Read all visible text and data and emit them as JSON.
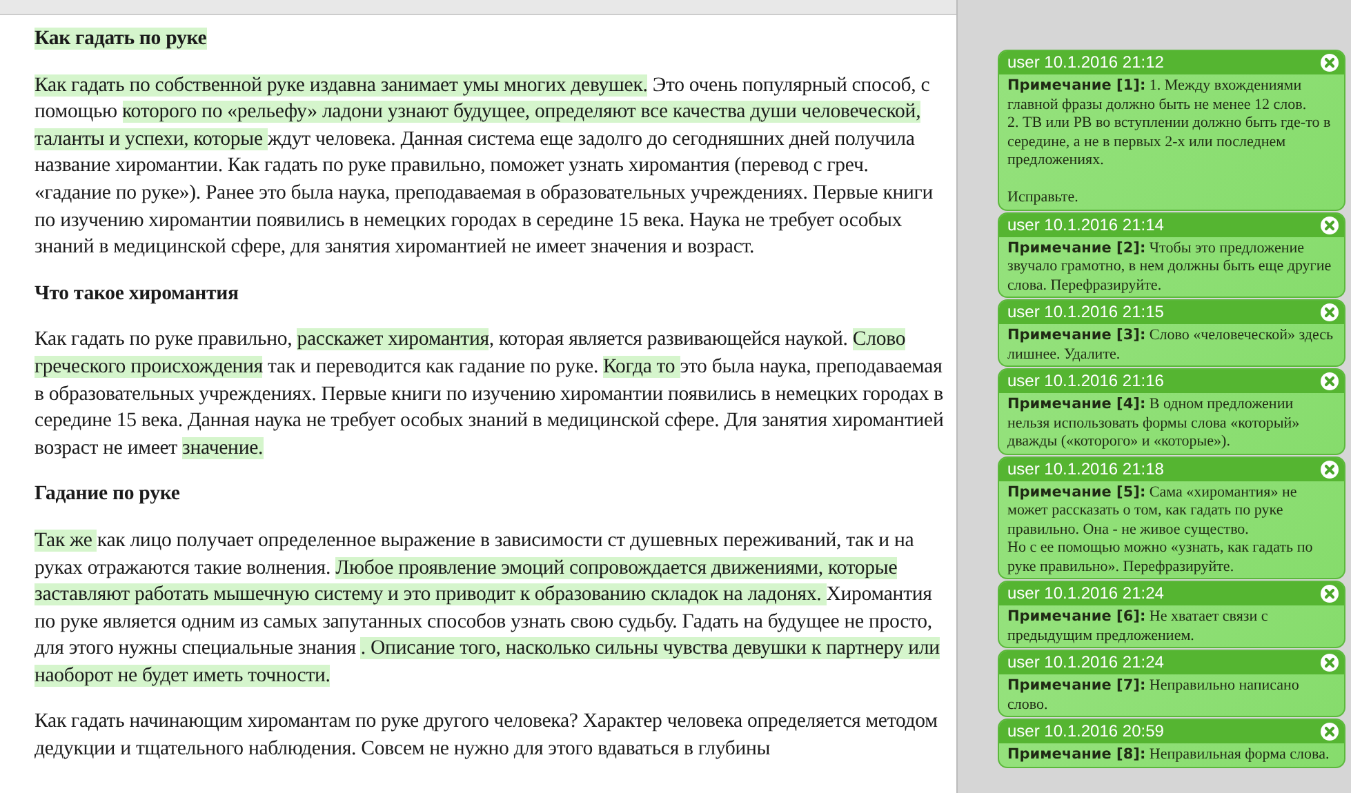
{
  "document": {
    "blocks": [
      {
        "kind": "heading",
        "segments": [
          {
            "text": "Как гадать по руке",
            "highlighted": true
          }
        ]
      },
      {
        "kind": "paragraph",
        "segments": [
          {
            "text": "Как гадать по собственной руке ",
            "highlighted": true
          },
          {
            "text": "издавна занимает умы многих девушек.",
            "highlighted": true
          },
          {
            "text": " Это очень популярный способ, с помощью ",
            "highlighted": false
          },
          {
            "text": "которого по «рельефу» ладони узнают будущее, определяют все качества ",
            "highlighted": true
          },
          {
            "text": "души человеческой",
            "highlighted": true
          },
          {
            "text": ", таланты и успехи, которые ",
            "highlighted": true
          },
          {
            "text": "ждут человека. Данная система еще задолго до сегодняшних дней получила название хиромантии. Как гадать по руке правильно, поможет узнать хиромантия (перевод с греч. «гадание по руке»). Ранее это была наука, преподаваемая в образовательных учреждениях. Первые книги по изучению хиромантии появились в немецких городах в середине 15 века. Наука не требует особых знаний в медицинской сфере, для занятия хиромантией не имеет значения и возраст.",
            "highlighted": false
          }
        ]
      },
      {
        "kind": "heading",
        "segments": [
          {
            "text": "Что такое хиромантия",
            "highlighted": false
          }
        ]
      },
      {
        "kind": "paragraph",
        "segments": [
          {
            "text": "Как гадать по руке правильно, ",
            "highlighted": false
          },
          {
            "text": "расскажет хиромантия",
            "highlighted": true
          },
          {
            "text": ", которая является развивающейся наукой. ",
            "highlighted": false
          },
          {
            "text": "Слово греческого происхождения",
            "highlighted": true
          },
          {
            "text": " так и переводится как гадание по руке. ",
            "highlighted": false
          },
          {
            "text": "Когда то ",
            "highlighted": true
          },
          {
            "text": "это была наука, преподаваемая в образовательных учреждениях. Первые книги по изучению хиромантии появились в немецких городах в середине 15 века. Данная наука не требует особых знаний в медицинской сфере. Для занятия хиромантией возраст не имеет ",
            "highlighted": false
          },
          {
            "text": "значение.",
            "highlighted": true
          }
        ]
      },
      {
        "kind": "heading",
        "segments": [
          {
            "text": "Гадание по руке",
            "highlighted": false
          }
        ]
      },
      {
        "kind": "paragraph",
        "segments": [
          {
            "text": "Так же ",
            "highlighted": true
          },
          {
            "text": "как лицо получает определенное выражение в зависимости ст душевных переживаний, так и на руках отражаются такие волнения. ",
            "highlighted": false
          },
          {
            "text": "Любое проявление эмоций сопровождается движениями, которые заставляют работать мышечную систему и это приводит к образованию складок на ладонях. ",
            "highlighted": true
          },
          {
            "text": "Хиромантия по руке является одним из самых запутанных способов узнать свою судьбу. Гадать на будущее не просто, для этого нужны специальные знания ",
            "highlighted": false
          },
          {
            "text": ". Описание того, насколько сильны чувства девушки к партнеру или наоборот не будет иметь точности.",
            "highlighted": true
          }
        ]
      },
      {
        "kind": "paragraph",
        "segments": [
          {
            "text": "Как гадать начинающим хиромантам по руке другого человека? Характер человека определяется методом дедукции и тщательного наблюдения. Совсем не нужно для этого вдаваться в глубины",
            "highlighted": false
          }
        ]
      }
    ]
  },
  "comments": [
    {
      "header": "user 10.1.2016 21:12",
      "label": "Примечание [1]:",
      "text": "1. Между вхождениями главной фразы должно быть не менее 12 слов.\n2. ТВ или РВ во вступлении должно быть где-то в середине, а не в первых 2-х или последнем предложениях.\n\nИсправьте."
    },
    {
      "header": "user 10.1.2016 21:14",
      "label": "Примечание [2]:",
      "text": "Чтобы это предложение звучало грамотно, в нем должны быть еще другие слова. Перефразируйте."
    },
    {
      "header": "user 10.1.2016 21:15",
      "label": "Примечание [3]:",
      "text": "Слово «человеческой» здесь лишнее. Удалите."
    },
    {
      "header": "user 10.1.2016 21:16",
      "label": "Примечание [4]:",
      "text": "В одном предложении нельзя использовать формы слова «который» дважды («которого» и «которые»)."
    },
    {
      "header": "user 10.1.2016 21:18",
      "label": "Примечание [5]:",
      "text": "Сама «хиромантия» не может рассказать о том, как гадать по руке правильно. Она - не живое существо.\nНо с ее помощью можно «узнать, как гадать по руке правильно». Перефразируйте."
    },
    {
      "header": "user 10.1.2016 21:24",
      "label": "Примечание [6]:",
      "text": "Не хватает связи с предыдущим предложением."
    },
    {
      "header": "user 10.1.2016 21:24",
      "label": "Примечание [7]:",
      "text": "Неправильно написано слово."
    },
    {
      "header": "user 10.1.2016 20:59",
      "label": "Примечание [8]:",
      "text": "Неправильная форма слова."
    }
  ]
}
